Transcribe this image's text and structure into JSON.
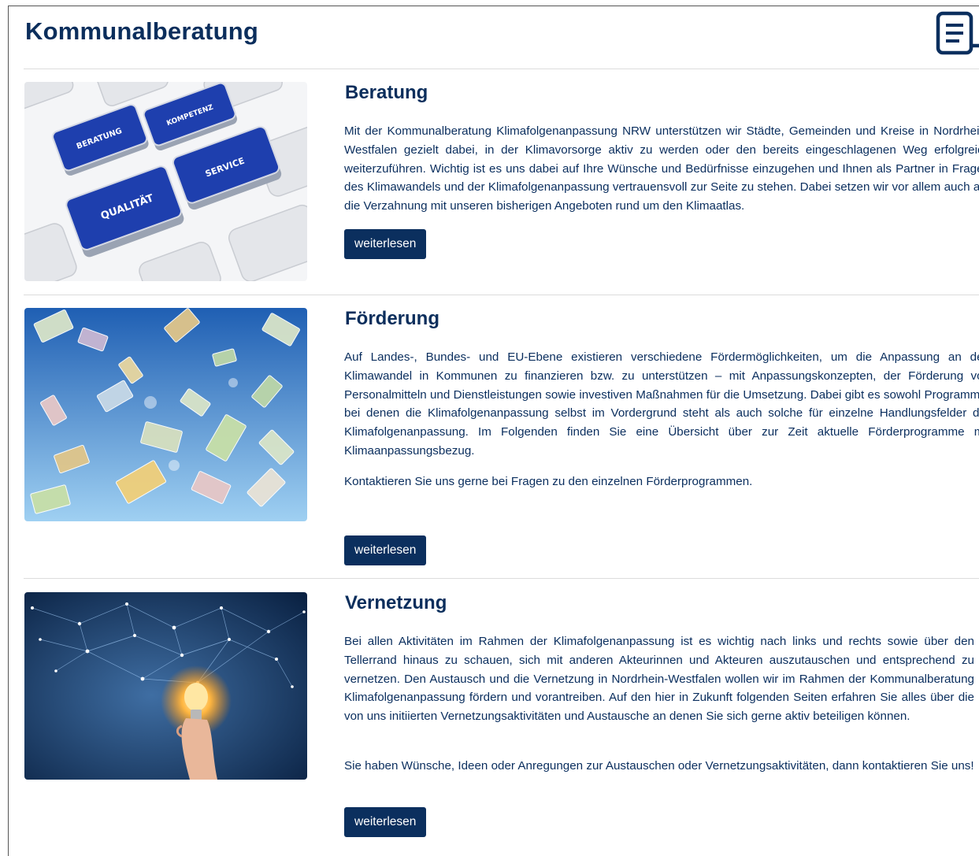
{
  "page": {
    "title": "Kommunalberatung"
  },
  "header": {
    "icon": "document-list-icon",
    "icon_color": "#0b2f5e"
  },
  "colors": {
    "heading": "#0b2e5c",
    "button_bg": "#0b2f5e",
    "button_text": "#ffffff"
  },
  "sections": [
    {
      "title": "Beratung",
      "image_tiles": [
        "BERATUNG",
        "KOMPETENZ",
        "SERVICE",
        "QUALITÄT"
      ],
      "paragraphs": [
        "Mit der Kommunalberatung Klimafolgenanpassung NRW unterstützen wir Städte, Gemeinden und Kreise in Nordrhein-Westfalen gezielt dabei, in der Klimavorsorge aktiv zu werden oder den bereits eingeschlagenen Weg erfolgreich weiterzuführen. Wichtig ist es uns dabei auf Ihre Wünsche und Bedürfnisse einzugehen und Ihnen als Partner in Fragen des Klimawandels und der Klimafolgenanpassung vertrauensvoll zur Seite zu stehen. Dabei setzen wir vor allem auch auf die Verzahnung mit unseren bisherigen Angeboten rund um den Klimaatlas."
      ],
      "button": "weiterlesen"
    },
    {
      "title": "Förderung",
      "paragraphs": [
        "Auf Landes-, Bundes- und EU-Ebene existieren verschiedene Fördermöglichkeiten, um die Anpassung an den Klimawandel in Kommunen zu finanzieren bzw. zu unterstützen – mit Anpassungskonzepten, der Förderung von Personalmitteln und Dienstleistungen sowie investiven Maßnahmen für die Umsetzung. Dabei gibt es sowohl Programme, bei denen die Klimafolgenanpassung selbst im Vordergrund steht als auch solche für einzelne Handlungsfelder der Klimafolgenanpassung. Im Folgenden finden Sie eine Übersicht über zur Zeit aktuelle Förderprogramme mit Klimaanpassungsbezug.",
        "Kontaktieren Sie uns gerne bei Fragen zu den einzelnen Förderprogrammen."
      ],
      "button": "weiterlesen"
    },
    {
      "title": "Vernetzung",
      "paragraphs": [
        "Bei allen Aktivitäten im Rahmen der Klimafolgenanpassung ist es wichtig nach links und rechts sowie über den Tellerrand hinaus zu schauen, sich mit anderen Akteurinnen und Akteuren auszutauschen und entsprechend zu vernetzen. Den Austausch und die Vernetzung in Nordrhein-Westfalen wollen wir im Rahmen der Kommunalberatung Klimafolgenanpassung fördern und vorantreiben. Auf den hier in Zukunft folgenden Seiten erfahren Sie alles über die von uns initiierten Vernetzungsaktivitäten und Austausche an denen Sie sich gerne aktiv beteiligen können.",
        "Sie haben Wünsche, Ideen oder Anregungen zur Austauschen oder Vernetzungsaktivitäten, dann kontaktieren Sie uns!"
      ],
      "button": "weiterlesen"
    }
  ]
}
